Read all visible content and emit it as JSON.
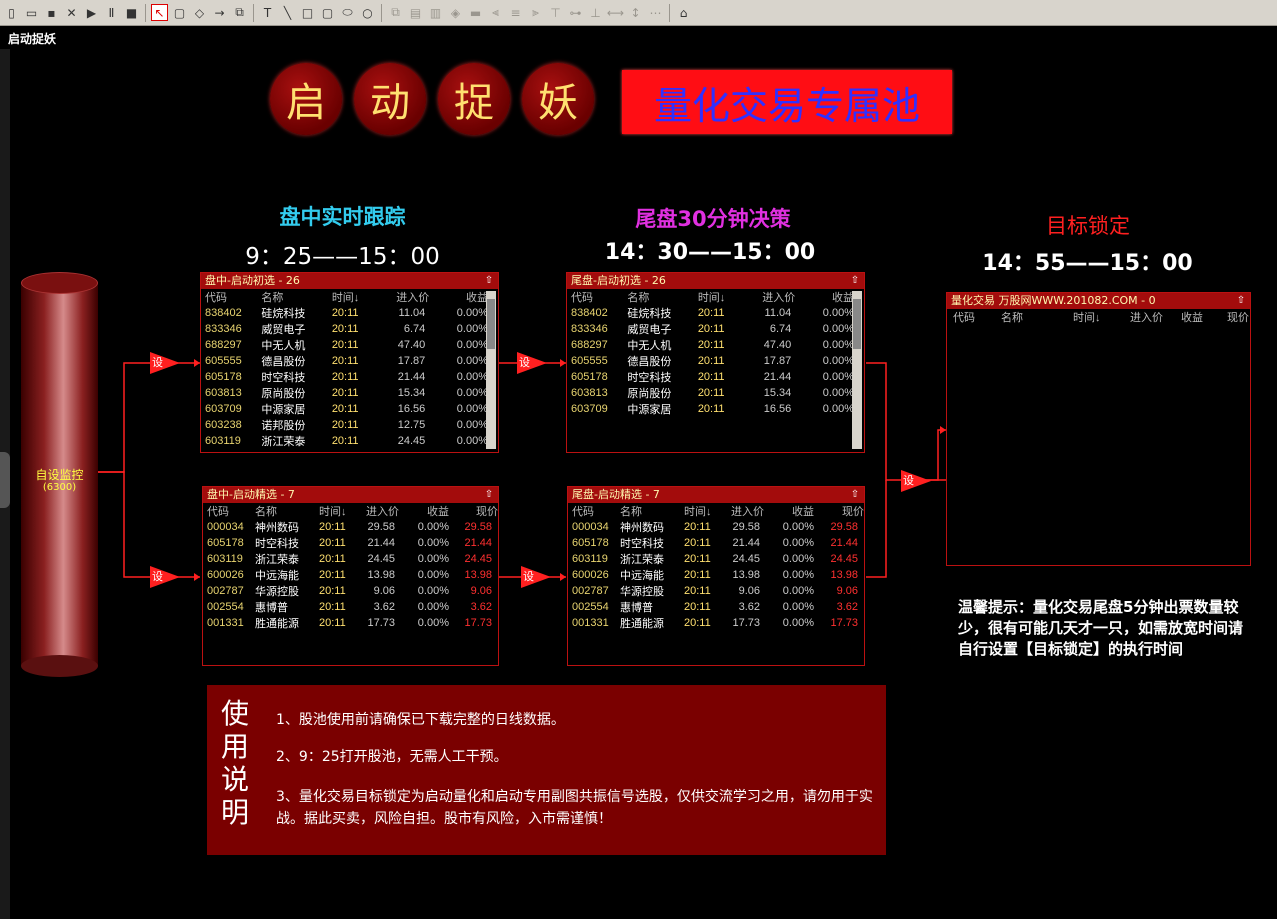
{
  "window": {
    "caption": "启动捉妖"
  },
  "toolbar": {
    "icons": [
      "new-doc-icon",
      "open-folder-icon",
      "save-icon",
      "delete-icon",
      "run-icon",
      "pause-icon",
      "stop-icon",
      "select-arrow-icon",
      "rect-select-icon",
      "node-icon",
      "line-arrow-icon",
      "move-icon",
      "text-tool-icon",
      "line-tool-icon",
      "rect-tool-icon",
      "round-rect-tool-icon",
      "ellipse-tool-icon",
      "circle-tool-icon",
      "copy-icon",
      "paste-icon",
      "trash-icon",
      "fill-icon",
      "line-width-icon",
      "align-left-icon",
      "align-center-icon",
      "align-right-icon",
      "align-top-icon",
      "align-middle-icon",
      "align-bottom-icon",
      "same-width-icon",
      "same-height-icon",
      "distribute-icon",
      "chart-icon"
    ]
  },
  "title": {
    "chars": [
      "启",
      "动",
      "捉",
      "妖"
    ],
    "banner": "量化交易专属池"
  },
  "sections": {
    "intraday": {
      "title": "盘中实时跟踪",
      "time": "9：25——15：00"
    },
    "tail": {
      "title": "尾盘30分钟决策",
      "time": "14：30——15：00"
    },
    "target": {
      "title": "目标锁定",
      "time": "14：55——15：00"
    }
  },
  "cylinder": {
    "label": "自设监控",
    "sub": "(6300)"
  },
  "set_label": "设",
  "columns5": [
    "代码",
    "名称",
    "时间↓",
    "进入价",
    "收益"
  ],
  "columns6": [
    "代码",
    "名称",
    "时间↓",
    "进入价",
    "收益",
    "现价"
  ],
  "target_columns": [
    "代码",
    "名称",
    "时间↓",
    "进入价",
    "收益",
    "现价"
  ],
  "panels": {
    "p1": {
      "title": "盘中-启动初选 - 26",
      "rows": [
        [
          "838402",
          "硅烷科技",
          "20:11",
          "11.04",
          "0.00%"
        ],
        [
          "833346",
          "威贸电子",
          "20:11",
          "6.74",
          "0.00%"
        ],
        [
          "688297",
          "中无人机",
          "20:11",
          "47.40",
          "0.00%"
        ],
        [
          "605555",
          "德昌股份",
          "20:11",
          "17.87",
          "0.00%"
        ],
        [
          "605178",
          "时空科技",
          "20:11",
          "21.44",
          "0.00%"
        ],
        [
          "603813",
          "原尚股份",
          "20:11",
          "15.34",
          "0.00%"
        ],
        [
          "603709",
          "中源家居",
          "20:11",
          "16.56",
          "0.00%"
        ],
        [
          "603238",
          "诺邦股份",
          "20:11",
          "12.75",
          "0.00%"
        ],
        [
          "603119",
          "浙江荣泰",
          "20:11",
          "24.45",
          "0.00%"
        ]
      ]
    },
    "p2": {
      "title": "尾盘-启动初选 - 26",
      "rows": [
        [
          "838402",
          "硅烷科技",
          "20:11",
          "11.04",
          "0.00%"
        ],
        [
          "833346",
          "威贸电子",
          "20:11",
          "6.74",
          "0.00%"
        ],
        [
          "688297",
          "中无人机",
          "20:11",
          "47.40",
          "0.00%"
        ],
        [
          "605555",
          "德昌股份",
          "20:11",
          "17.87",
          "0.00%"
        ],
        [
          "605178",
          "时空科技",
          "20:11",
          "21.44",
          "0.00%"
        ],
        [
          "603813",
          "原尚股份",
          "20:11",
          "15.34",
          "0.00%"
        ],
        [
          "603709",
          "中源家居",
          "20:11",
          "16.56",
          "0.00%"
        ]
      ]
    },
    "p3": {
      "title": "盘中-启动精选 - 7",
      "rows": [
        [
          "000034",
          "神州数码",
          "20:11",
          "29.58",
          "0.00%",
          "29.58"
        ],
        [
          "605178",
          "时空科技",
          "20:11",
          "21.44",
          "0.00%",
          "21.44"
        ],
        [
          "603119",
          "浙江荣泰",
          "20:11",
          "24.45",
          "0.00%",
          "24.45"
        ],
        [
          "600026",
          "中远海能",
          "20:11",
          "13.98",
          "0.00%",
          "13.98"
        ],
        [
          "002787",
          "华源控股",
          "20:11",
          "9.06",
          "0.00%",
          "9.06"
        ],
        [
          "002554",
          "惠博普",
          "20:11",
          "3.62",
          "0.00%",
          "3.62"
        ],
        [
          "001331",
          "胜通能源",
          "20:11",
          "17.73",
          "0.00%",
          "17.73"
        ]
      ]
    },
    "p4": {
      "title": "尾盘-启动精选 - 7",
      "rows": [
        [
          "000034",
          "神州数码",
          "20:11",
          "29.58",
          "0.00%",
          "29.58"
        ],
        [
          "605178",
          "时空科技",
          "20:11",
          "21.44",
          "0.00%",
          "21.44"
        ],
        [
          "603119",
          "浙江荣泰",
          "20:11",
          "24.45",
          "0.00%",
          "24.45"
        ],
        [
          "600026",
          "中远海能",
          "20:11",
          "13.98",
          "0.00%",
          "13.98"
        ],
        [
          "002787",
          "华源控股",
          "20:11",
          "9.06",
          "0.00%",
          "9.06"
        ],
        [
          "002554",
          "惠博普",
          "20:11",
          "3.62",
          "0.00%",
          "3.62"
        ],
        [
          "001331",
          "胜通能源",
          "20:11",
          "17.73",
          "0.00%",
          "17.73"
        ]
      ]
    },
    "p5": {
      "title": "量化交易 万股网WWW.201082.COM - 0",
      "rows": []
    }
  },
  "usage": {
    "title": [
      "使",
      "用",
      "说",
      "明"
    ],
    "lines": [
      "1、股池使用前请确保已下载完整的日线数据。",
      "2、9：25打开股池，无需人工干预。",
      "3、量化交易目标锁定为启动量化和启动专用副图共振信号选股，仅供交流学习之用，请勿用于实战。据此买卖，风险自担。股市有风险，入市需谨慎！"
    ]
  },
  "tip": "温馨提示：量化交易尾盘5分钟出票数量较少，很有可能几天才一只，如需放宽时间请自行设置【目标锁定】的执行时间",
  "colors": {
    "accent_red": "#a30c0c",
    "banner_red": "#ff0d14",
    "cyan": "#33ccee",
    "magenta": "#e030e0",
    "target_red": "#ff2020"
  }
}
